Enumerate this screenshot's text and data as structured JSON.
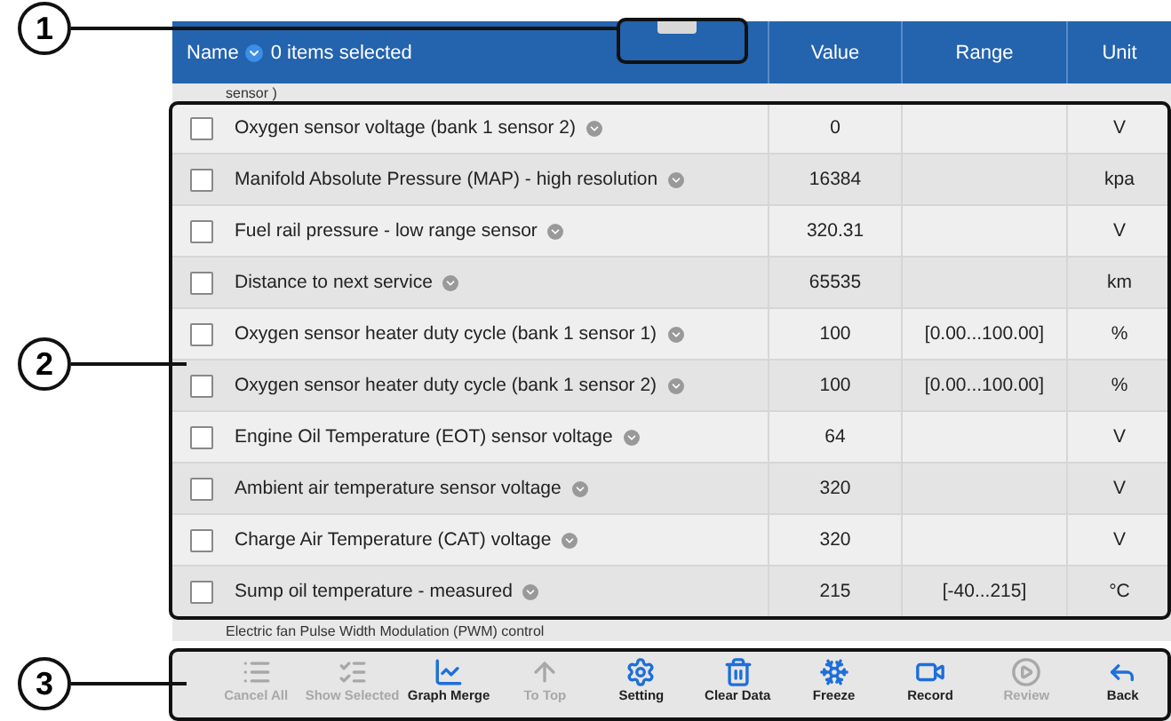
{
  "callouts": [
    "1",
    "2",
    "3"
  ],
  "table": {
    "columns": [
      {
        "label": "Name",
        "selection": "0 items selected"
      },
      {
        "label": "Value"
      },
      {
        "label": "Range"
      },
      {
        "label": "Unit"
      }
    ],
    "partial_top": "sensor )",
    "rows": [
      {
        "name": "Oxygen sensor voltage (bank 1 sensor 2)",
        "value": "0",
        "range": "",
        "unit": "V",
        "checked": false
      },
      {
        "name": "Manifold Absolute Pressure (MAP) - high resolution",
        "value": "16384",
        "range": "",
        "unit": "kpa",
        "checked": false
      },
      {
        "name": "Fuel rail pressure - low range sensor",
        "value": "320.31",
        "range": "",
        "unit": "V",
        "checked": false
      },
      {
        "name": "Distance to next service",
        "value": "65535",
        "range": "",
        "unit": "km",
        "checked": false
      },
      {
        "name": "Oxygen sensor heater duty cycle (bank 1 sensor 1)",
        "value": "100",
        "range": "[0.00...100.00]",
        "unit": "%",
        "checked": false
      },
      {
        "name": "Oxygen sensor heater duty cycle (bank 1 sensor 2)",
        "value": "100",
        "range": "[0.00...100.00]",
        "unit": "%",
        "checked": false
      },
      {
        "name": "Engine Oil Temperature (EOT) sensor voltage",
        "value": "64",
        "range": "",
        "unit": "V",
        "checked": false
      },
      {
        "name": "Ambient air temperature sensor voltage",
        "value": "320",
        "range": "",
        "unit": "V",
        "checked": false
      },
      {
        "name": "Charge Air Temperature (CAT) voltage",
        "value": "320",
        "range": "",
        "unit": "V",
        "checked": false
      },
      {
        "name": "Sump oil temperature - measured",
        "value": "215",
        "range": "[-40...215]",
        "unit": "°C",
        "checked": false
      }
    ],
    "partial_bottom": "Electric fan Pulse Width Modulation (PWM) control"
  },
  "toolbar": [
    {
      "kind": "cancel",
      "label": "Cancel All",
      "disabled": true
    },
    {
      "kind": "show",
      "label": "Show Selected",
      "disabled": true
    },
    {
      "kind": "graph",
      "label": "Graph Merge",
      "disabled": false
    },
    {
      "kind": "top",
      "label": "To Top",
      "disabled": true
    },
    {
      "kind": "setting",
      "label": "Setting",
      "disabled": false
    },
    {
      "kind": "clear",
      "label": "Clear Data",
      "disabled": false
    },
    {
      "kind": "freeze",
      "label": "Freeze",
      "disabled": false
    },
    {
      "kind": "record",
      "label": "Record",
      "disabled": false
    },
    {
      "kind": "review",
      "label": "Review",
      "disabled": true
    },
    {
      "kind": "back",
      "label": "Back",
      "disabled": false
    }
  ]
}
